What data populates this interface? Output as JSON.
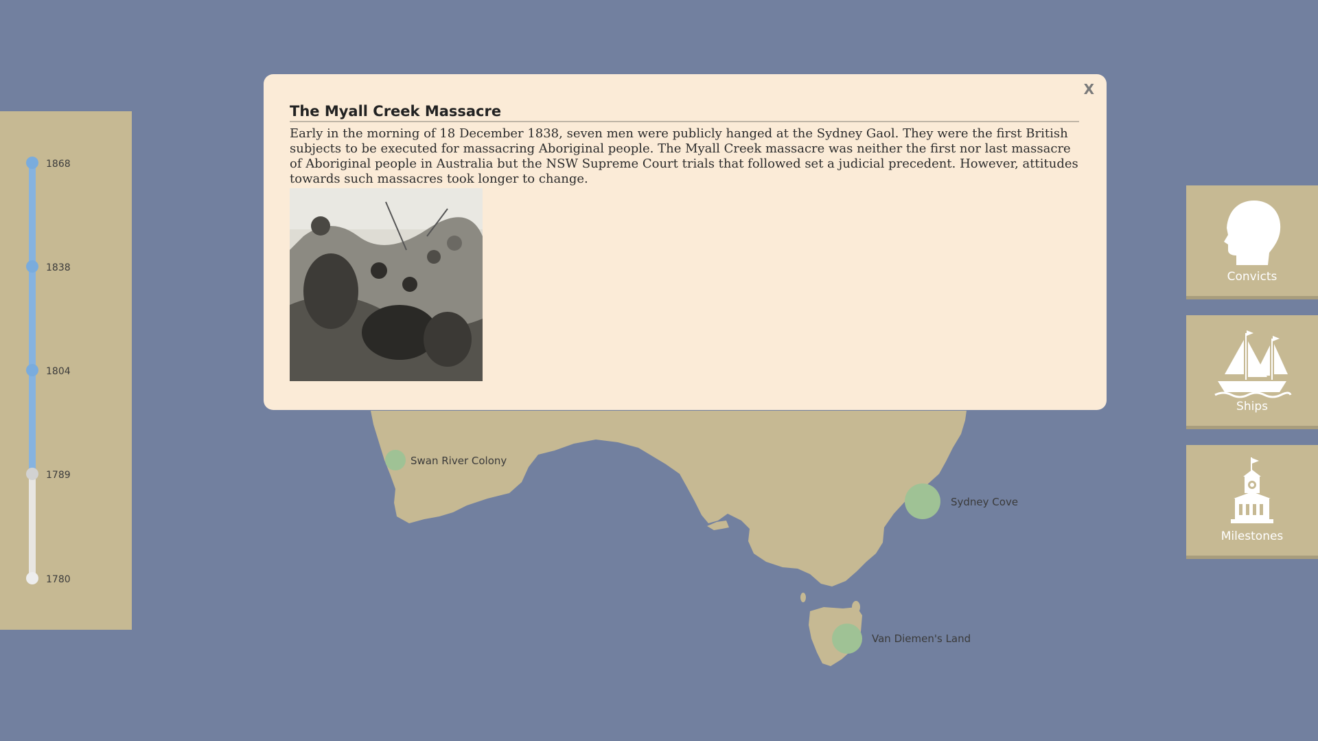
{
  "timeline": {
    "ticks": [
      {
        "label": "1868",
        "state": "active"
      },
      {
        "label": "1838",
        "state": "active"
      },
      {
        "label": "1804",
        "state": "active"
      },
      {
        "label": "1789",
        "state": "current"
      },
      {
        "label": "1780",
        "state": "inactive"
      }
    ],
    "colors": {
      "active": "#7aacdd",
      "track": "#86b3e0",
      "inactive": "#ededed"
    }
  },
  "modal": {
    "close_label": "X",
    "title": "The Myall Creek Massacre",
    "body": "Early in the morning of 18 December 1838, seven men were publicly hanged at the Sydney Gaol. They were the first British subjects to be executed for massacring Aboriginal people. The Myall Creek massacre was neither the first nor last massacre of Aboriginal people in Australia but the NSW Supreme Court trials that followed set a judicial precedent. However, attitudes towards such massacres took longer to change."
  },
  "map": {
    "places": [
      {
        "label": "Swan River Colony"
      },
      {
        "label": "Sydney Cove"
      },
      {
        "label": "Van Diemen's Land"
      }
    ],
    "colors": {
      "land": "#c6b993",
      "sea": "#72809f",
      "marker": "#9fc295"
    }
  },
  "categories": [
    {
      "label": "Convicts",
      "icon": "head-silhouette-icon"
    },
    {
      "label": "Ships",
      "icon": "sailing-ship-icon"
    },
    {
      "label": "Milestones",
      "icon": "clock-tower-icon"
    }
  ]
}
